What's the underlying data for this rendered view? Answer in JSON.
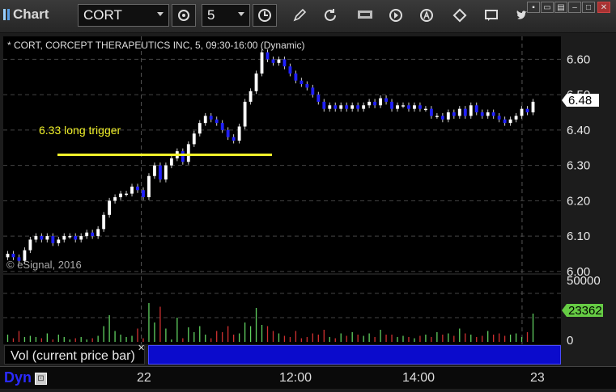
{
  "app": {
    "title": "Chart"
  },
  "toolbar": {
    "symbol": "CORT",
    "interval": "5"
  },
  "chart": {
    "header": "* CORT, CORCEPT THERAPEUTICS INC, 5, 09:30-16:00 (Dynamic)",
    "annotation": "6.33 long trigger",
    "annotation_color": "#f2f22a",
    "watermark": "© eSignal, 2016",
    "current_price_label": "6.48",
    "volume_label": "Vol (current price bar)",
    "volume_current_label": "23362",
    "volume_axis_top": "50000",
    "volume_axis_bottom": "0",
    "dyn_label": "Dyn",
    "x_ticks": [
      "22",
      "12:00",
      "14:00",
      "23"
    ],
    "up_color": "#ffffff",
    "down_color": "#2020ff",
    "vol_up_color": "#60d060",
    "vol_down_color": "#d03030"
  },
  "chart_data": {
    "type": "candlestick",
    "title": "* CORT, CORCEPT THERAPEUTICS INC, 5, 09:30-16:00 (Dynamic)",
    "y_ticks": [
      6.0,
      6.1,
      6.2,
      6.3,
      6.4,
      6.5,
      6.6
    ],
    "ylim": [
      5.995,
      6.665
    ],
    "volume_ylim": [
      0,
      52000
    ],
    "horizontal_line": 6.33,
    "last_price": 6.48,
    "last_volume": 23362,
    "close": [
      6.05,
      6.04,
      6.03,
      6.06,
      6.09,
      6.1,
      6.09,
      6.1,
      6.08,
      6.09,
      6.1,
      6.1,
      6.09,
      6.1,
      6.11,
      6.1,
      6.12,
      6.16,
      6.2,
      6.21,
      6.22,
      6.22,
      6.24,
      6.23,
      6.21,
      6.27,
      6.3,
      6.26,
      6.3,
      6.32,
      6.34,
      6.31,
      6.36,
      6.39,
      6.42,
      6.44,
      6.43,
      6.42,
      6.4,
      6.38,
      6.37,
      6.41,
      6.48,
      6.51,
      6.56,
      6.62,
      6.6,
      6.59,
      6.6,
      6.58,
      6.56,
      6.54,
      6.53,
      6.52,
      6.5,
      6.48,
      6.46,
      6.47,
      6.46,
      6.47,
      6.46,
      6.47,
      6.46,
      6.47,
      6.48,
      6.47,
      6.49,
      6.48,
      6.46,
      6.47,
      6.47,
      6.46,
      6.47,
      6.46,
      6.46,
      6.44,
      6.44,
      6.43,
      6.45,
      6.44,
      6.46,
      6.44,
      6.47,
      6.45,
      6.44,
      6.45,
      6.44,
      6.43,
      6.42,
      6.43,
      6.44,
      6.46,
      6.45,
      6.48
    ],
    "volume": [
      6000,
      3000,
      9000,
      4000,
      5000,
      4000,
      3000,
      7000,
      2000,
      6000,
      4000,
      2000,
      3000,
      4000,
      2000,
      3000,
      5000,
      13000,
      22000,
      9000,
      6000,
      4000,
      5000,
      11000,
      3000,
      32000,
      16000,
      29000,
      11000,
      2000,
      20000,
      3000,
      12000,
      8000,
      13000,
      6000,
      3000,
      9000,
      8000,
      13000,
      6000,
      7000,
      16000,
      13000,
      28000,
      14000,
      13000,
      9000,
      7000,
      5000,
      4000,
      9000,
      3000,
      4000,
      7000,
      6000,
      10000,
      4000,
      3000,
      7000,
      5000,
      8000,
      6000,
      5000,
      7000,
      4000,
      10000,
      6000,
      6000,
      4000,
      5000,
      4000,
      3000,
      5000,
      6000,
      4000,
      8000,
      6000,
      7000,
      5000,
      11000,
      7000,
      6000,
      4000,
      5000,
      9000,
      6000,
      7000,
      5000,
      6000,
      7000,
      4000,
      8000,
      23362
    ]
  }
}
